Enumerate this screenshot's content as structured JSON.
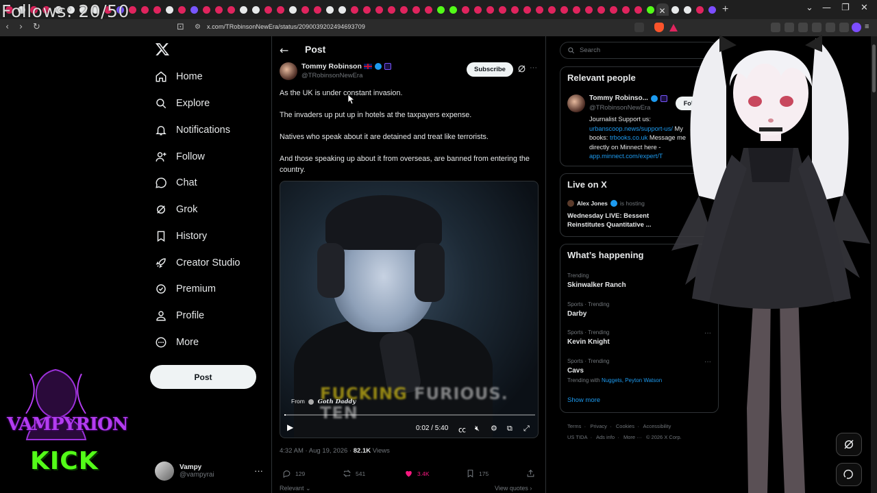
{
  "overlay": {
    "follows": "Follows: 20/50"
  },
  "browser": {
    "url": "x.com/TRobinsonNewEra/status/2090039202494693709",
    "tab_close": "✕",
    "new_tab": "+"
  },
  "sidebar": {
    "items": [
      {
        "label": "Home",
        "icon": "home-icon"
      },
      {
        "label": "Explore",
        "icon": "search-icon"
      },
      {
        "label": "Notifications",
        "icon": "bell-icon"
      },
      {
        "label": "Follow",
        "icon": "person-add-icon"
      },
      {
        "label": "Chat",
        "icon": "chat-icon"
      },
      {
        "label": "Grok",
        "icon": "grok-icon"
      },
      {
        "label": "History",
        "icon": "bookmark-icon"
      },
      {
        "label": "Creator Studio",
        "icon": "rocket-icon"
      },
      {
        "label": "Premium",
        "icon": "verified-icon"
      },
      {
        "label": "Profile",
        "icon": "person-icon"
      },
      {
        "label": "More",
        "icon": "more-circle-icon"
      }
    ],
    "post_button": "Post",
    "account": {
      "name": "Vampy",
      "handle": "@vampyrai"
    }
  },
  "streamer_logo": {
    "name": "VAMPYRION",
    "platform": "KICK"
  },
  "post": {
    "header_title": "Post",
    "author": {
      "name": "Tommy Robinson",
      "handle": "@TRobinsonNewEra"
    },
    "subscribe_label": "Subscribe",
    "lines": [
      "As the UK is under constant invasion.",
      "The invaders up put up in hotels at the taxpayers expense.",
      "Natives who speak about it are detained and treat like terrorists.",
      "And those speaking up about it from overseas, are banned from entering the country."
    ],
    "video": {
      "caption_yellow": "FUCKING",
      "caption_white": " FURIOUS. TEN",
      "from": "From",
      "channel": "Goth Daddy",
      "time": "0:02 / 5:40",
      "progress": 0.006
    },
    "timestamp": "4:32 AM · Aug 19, 2026 · ",
    "views_count": "82.1K",
    "views_label": " Views",
    "actions": {
      "replies": "129",
      "reposts": "541",
      "likes": "3.4K",
      "bookmarks": "175"
    },
    "relevant": "Relevant ⌄",
    "view_quotes": "View quotes ›"
  },
  "right": {
    "search_placeholder": "Search",
    "relevant_people": {
      "title": "Relevant people",
      "name": "Tommy Robinso...",
      "handle": "@TRobinsonNewEra",
      "follow": "Follow",
      "bio_1": "Journalist Support us:",
      "bio_link_1": "urbanscoop.news/support-us/",
      "bio_2": " My",
      "bio_3": "books: ",
      "bio_link_2": "trbooks.co.uk",
      "bio_4": " Message me",
      "bio_5": "directly on Minnect here -",
      "bio_link_3": "app.minnect.com/expert/T"
    },
    "live": {
      "title": "Live on X",
      "host": "Alex Jones",
      "hosting": "is hosting",
      "event": "Wednesday LIVE: Bessent Reinstitutes Quantitative ..."
    },
    "happening": {
      "title": "What’s happening",
      "trends": [
        {
          "category": "Trending",
          "name": "Skinwalker Ranch"
        },
        {
          "category": "Sports · Trending",
          "name": "Darby"
        },
        {
          "category": "Sports · Trending",
          "name": "Kevin Knight"
        },
        {
          "category": "Sports · Trending",
          "name": "Cavs",
          "with": "Trending with ",
          "with_links": "Nuggets, Peyton Watson"
        }
      ],
      "show_more": "Show more"
    },
    "footer": {
      "line1": [
        "Terms",
        "Privacy",
        "Cookies",
        "Accessibility"
      ],
      "line2": [
        "US TIDA",
        "Ads info",
        "More ···",
        "© 2026 X Corp."
      ]
    }
  },
  "colors": {
    "accent": "#1d9bf0",
    "like": "#f91880",
    "bg": "#000000",
    "border": "#2f3336",
    "kick": "#53fc18",
    "vamp": "#b33cf0"
  }
}
